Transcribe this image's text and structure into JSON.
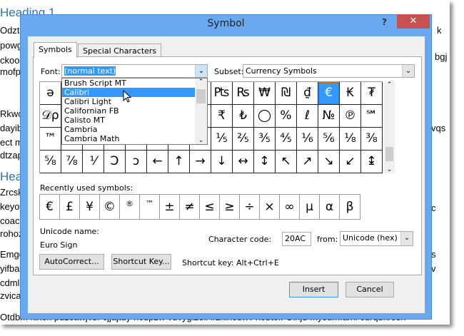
{
  "document": {
    "heading1": "Heading 1",
    "heading2": "Head",
    "left_lines": [
      "Odzt u",
      "powg",
      "ckoom",
      "mofpv",
      "Rkwol",
      "dayibl",
      "ect mj",
      "dtzap",
      "Zrcsk",
      "keyov",
      "coacls",
      "rohozk",
      "Emggv",
      "yifbac",
      "cdml p",
      "zvica p"
    ],
    "right_lines": [
      "k",
      "bgj",
      "vqs",
      "c",
      "s",
      "v"
    ],
    "bottom_line": "Otdbm kixox puzcawjvbf cjjajtuy hcdpzw vuvygizeii lrzxlncdwv xobtol. Oihju mysdmfaml cdrqbkrceh"
  },
  "dialog": {
    "title": "Symbol",
    "help": "?",
    "close": "✕",
    "tabs": [
      "Symbols",
      "Special Characters"
    ],
    "font_label": "Font:",
    "font_value": "(normal text)",
    "subset_label": "Subset:",
    "subset_value": "Currency Symbols",
    "font_list": [
      "Brush Script MT",
      "Calibri",
      "Calibri Light",
      "Californian FB",
      "Calisto MT",
      "Cambria",
      "Cambria Math"
    ],
    "font_list_highlighted": "Calibri",
    "symbols": [
      [
        "ə",
        "",
        "",
        "",
        "",
        "",
        "",
        "",
        "₧",
        "₨",
        "₩",
        "₪",
        "₫",
        "€",
        "₭",
        "₮"
      ],
      [
        "𝒟ρ",
        "",
        "",
        "",
        "",
        "",
        "",
        "",
        "₹",
        "₺",
        "◯",
        "%",
        "ℓ",
        "№",
        "℗",
        "℠"
      ],
      [
        "™",
        "",
        "",
        "",
        "",
        "",
        "",
        "",
        "⅕",
        "⅖",
        "⅗",
        "⅘",
        "⅙",
        "⅚",
        "⅛",
        "⅜"
      ],
      [
        "⅝",
        "⅞",
        "⅟",
        "Ↄ",
        "ↄ",
        "←",
        "↑",
        "→",
        "↓",
        "↔",
        "↕",
        "↖",
        "↗",
        "↘",
        "↙",
        "↨"
      ]
    ],
    "selected_symbol": "€",
    "recent_label": "Recently used symbols:",
    "recent": [
      "€",
      "£",
      "¥",
      "©",
      "®",
      "™",
      "±",
      "≠",
      "≤",
      "≥",
      "÷",
      "×",
      "∞",
      "µ",
      "α",
      "β"
    ],
    "unicode_name_label": "Unicode name:",
    "unicode_name": "Euro Sign",
    "char_code_label": "Character code:",
    "char_code": "20AC",
    "from_label": "from:",
    "from_value": "Unicode (hex)",
    "autocorrect": "AutoCorrect...",
    "shortcut_key_btn": "Shortcut Key...",
    "shortcut_text": "Shortcut key: Alt+Ctrl+E",
    "insert": "Insert",
    "cancel": "Cancel",
    "accent": "#3399ff",
    "title_bar": "#6aa9f0",
    "close_color": "#c75050"
  }
}
